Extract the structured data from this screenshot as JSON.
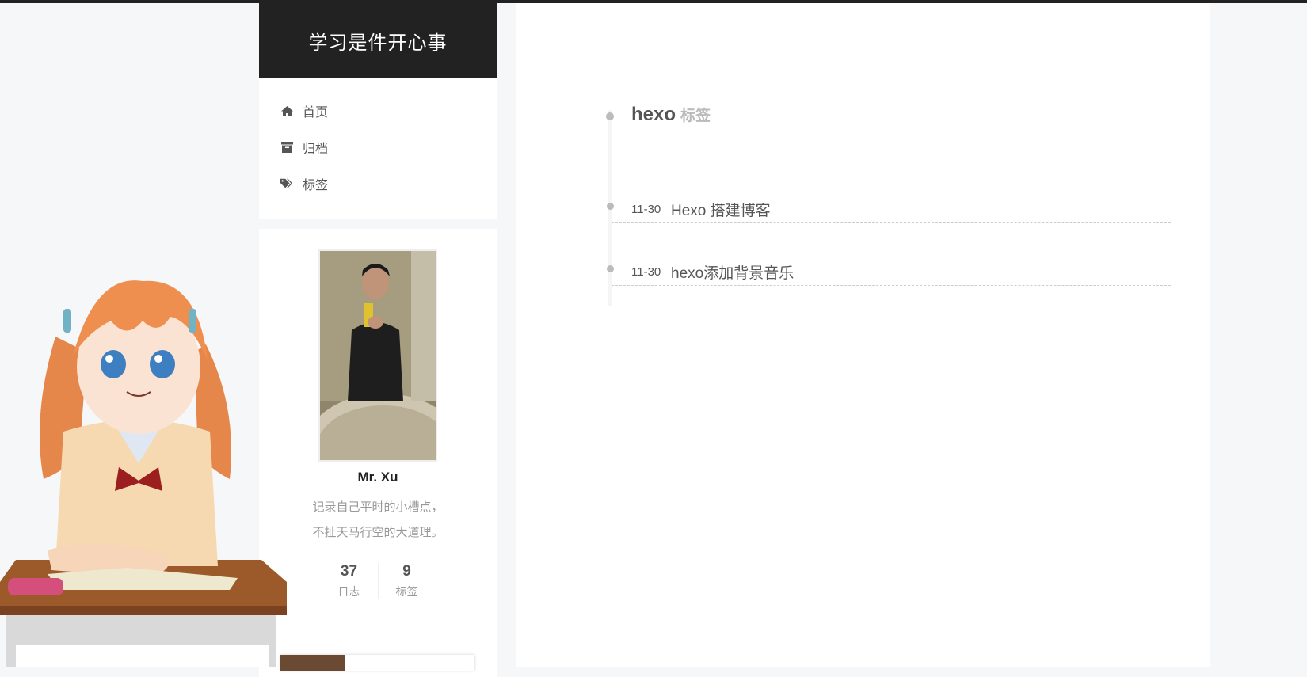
{
  "site": {
    "title": "学习是件开心事"
  },
  "menu": [
    {
      "label": "首页",
      "icon": "home-icon"
    },
    {
      "label": "归档",
      "icon": "archive-icon"
    },
    {
      "label": "标签",
      "icon": "tags-icon"
    }
  ],
  "profile": {
    "name": "Mr. Xu",
    "description_line1": "记录自己平时的小槽点，",
    "description_line2": "不扯天马行空的大道理。",
    "stats": [
      {
        "count": "37",
        "label": "日志"
      },
      {
        "count": "9",
        "label": "标签"
      }
    ]
  },
  "tag_page": {
    "tag": "hexo",
    "suffix": "标签",
    "posts": [
      {
        "date": "11-30",
        "title": "Hexo 搭建博客"
      },
      {
        "date": "11-30",
        "title": "hexo添加背景音乐"
      }
    ]
  },
  "colors": {
    "header_bg": "#222222",
    "page_bg": "#f5f7f9",
    "accent_gray": "#bbbbbb"
  }
}
